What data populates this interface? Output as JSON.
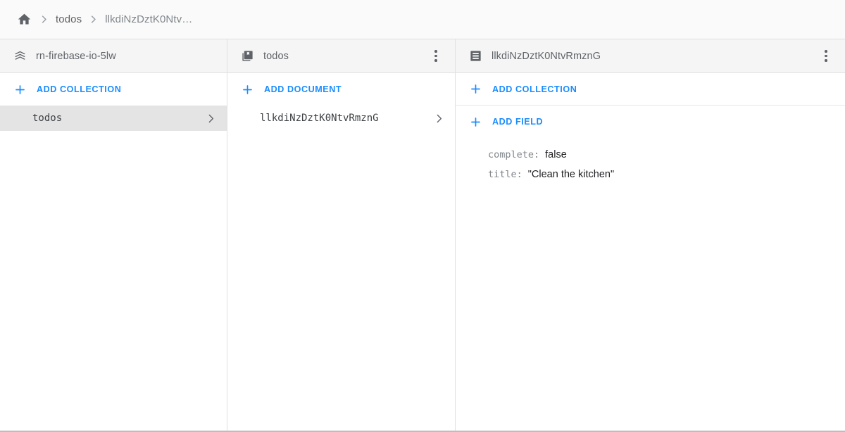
{
  "breadcrumb": {
    "home_icon": "home-icon",
    "separator_icon": "chevron-right-icon",
    "items": [
      {
        "label": "todos",
        "current": false
      },
      {
        "label": "llkdiNzDztK0Ntv…",
        "current": true
      }
    ]
  },
  "columns": {
    "projects": {
      "header": {
        "icon": "firestore-stack-icon",
        "title": "rn-firebase-io-5lw"
      },
      "add_action": {
        "icon": "plus-icon",
        "label": "ADD COLLECTION"
      },
      "rows": [
        {
          "label": "todos",
          "selected": true,
          "chevron_icon": "chevron-right-icon"
        }
      ]
    },
    "collection": {
      "header": {
        "icon": "collection-icon",
        "title": "todos",
        "menu_icon": "more-vert-icon"
      },
      "add_action": {
        "icon": "plus-icon",
        "label": "ADD DOCUMENT"
      },
      "rows": [
        {
          "label": "llkdiNzDztK0NtvRmznG",
          "selected": false,
          "chevron_icon": "chevron-right-icon"
        }
      ]
    },
    "document": {
      "header": {
        "icon": "document-icon",
        "title": "llkdiNzDztK0NtvRmznG",
        "menu_icon": "more-vert-icon"
      },
      "add_collection": {
        "icon": "plus-icon",
        "label": "ADD COLLECTION"
      },
      "add_field": {
        "icon": "plus-icon",
        "label": "ADD FIELD"
      },
      "fields": [
        {
          "key": "complete:",
          "value": "false"
        },
        {
          "key": "title:",
          "value": "\"Clean the kitchen\""
        }
      ]
    }
  },
  "colors": {
    "accent_blue": "#1a8cff",
    "header_bg": "#f5f5f5",
    "selected_row_bg": "#e4e4e4",
    "text_primary": "#202124",
    "text_secondary": "#5f6368"
  }
}
